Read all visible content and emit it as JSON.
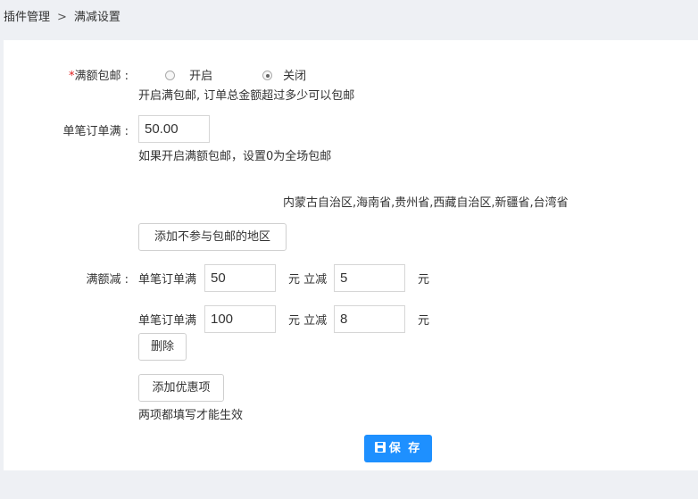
{
  "breadcrumb": {
    "root": "插件管理",
    "separator": ">",
    "current": "满减设置"
  },
  "free_shipping": {
    "required_mark": "*",
    "label": "满额包邮 :",
    "options": [
      {
        "label": "开启",
        "checked": false
      },
      {
        "label": "关闭",
        "checked": true
      }
    ],
    "hint": "开启满包邮, 订单总金额超过多少可以包邮"
  },
  "order_threshold": {
    "label": "单笔订单满 :",
    "value": "50.00",
    "hint": "如果开启满额包邮，设置0为全场包邮"
  },
  "excluded_regions": {
    "text": "内蒙古自治区,海南省,贵州省,西藏自治区,新疆省,台湾省",
    "add_button": "添加不参与包邮的地区"
  },
  "discount": {
    "label": "满额减 :",
    "rows": [
      {
        "prefix": "单笔订单满",
        "threshold": "50",
        "middle": "元 立减",
        "amount": "5",
        "suffix": "元"
      },
      {
        "prefix": "单笔订单满",
        "threshold": "100",
        "middle": "元 立减",
        "amount": "8",
        "suffix": "元"
      }
    ],
    "delete_button": "删除",
    "add_button": "添加优惠项",
    "hint": "两项都填写才能生效"
  },
  "save_button": "保 存",
  "colors": {
    "accent": "#1e90ff",
    "required": "#e02020",
    "page_bg": "#eef0f4"
  }
}
